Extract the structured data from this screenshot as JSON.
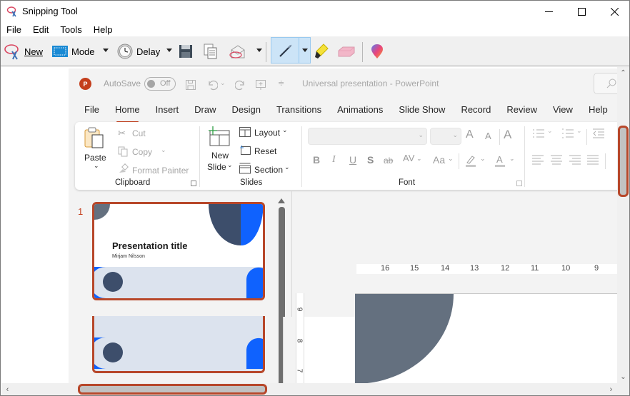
{
  "window": {
    "title": "Snipping Tool",
    "controls": [
      "minimize",
      "maximize",
      "close"
    ]
  },
  "menu": [
    "File",
    "Edit",
    "Tools",
    "Help"
  ],
  "toolbar": {
    "new_label": "New",
    "mode_label": "Mode",
    "delay_label": "Delay",
    "icons": [
      "new-snip-icon",
      "mode-icon",
      "delay-clock-icon",
      "save-icon",
      "copy-icon",
      "send-email-icon",
      "pen-icon",
      "highlighter-icon",
      "eraser-icon",
      "paint3d-icon"
    ]
  },
  "ppt": {
    "app_logo": "P",
    "autosave_label": "AutoSave",
    "autosave_state": "Off",
    "doc_title": "Universal presentation  -  PowerPoint",
    "tabs": [
      "File",
      "Home",
      "Insert",
      "Draw",
      "Design",
      "Transitions",
      "Animations",
      "Slide Show",
      "Record",
      "Review",
      "View",
      "Help"
    ],
    "active_tab": "Home",
    "ribbon": {
      "clipboard": {
        "paste": "Paste",
        "cut": "Cut",
        "copy": "Copy",
        "format_painter": "Format Painter",
        "label": "Clipboard"
      },
      "slides": {
        "new_slide_line1": "New",
        "new_slide_line2": "Slide",
        "layout": "Layout",
        "reset": "Reset",
        "section": "Section",
        "label": "Slides"
      },
      "font": {
        "bold": "B",
        "italic": "I",
        "underline": "U",
        "shadow": "S",
        "strikethrough": "ab",
        "spacing": "AV",
        "case": "Aa",
        "grow": "A",
        "shrink": "A",
        "label": "Font"
      }
    },
    "slide_pane": {
      "slide_number": "1",
      "thumb_title": "Presentation title",
      "thumb_subtitle": "Mirjam Nilsson"
    },
    "ruler_h": [
      "16",
      "15",
      "14",
      "13",
      "12",
      "11",
      "10",
      "9"
    ],
    "ruler_v": [
      "9",
      "8",
      "7"
    ]
  },
  "colors": {
    "ppt_accent": "#c43e1c",
    "thumb_border": "#b7472a",
    "slide_dark": "#3d4e6b",
    "slide_blue": "#0f62fe",
    "slide_light": "#dce3ee",
    "editor_shape": "#64707f",
    "pen_active_bg": "#cce4f7"
  }
}
